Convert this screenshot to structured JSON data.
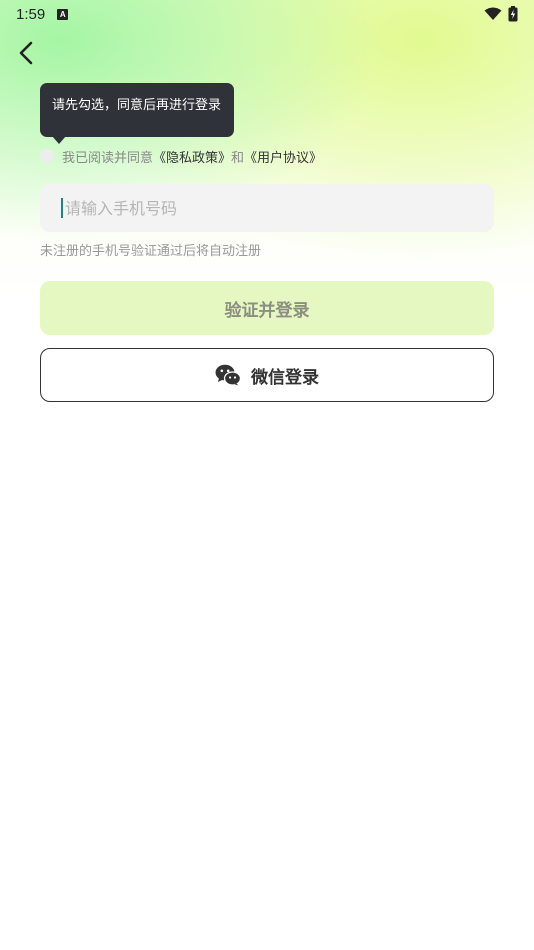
{
  "status_bar": {
    "time": "1:59",
    "notification_icon": "a-icon",
    "wifi_icon": "wifi-icon",
    "battery_icon": "battery-charging-icon"
  },
  "nav": {
    "back_icon": "chevron-left-icon"
  },
  "tooltip": {
    "text": "请先勾选，同意后再进行登录"
  },
  "agreement": {
    "prefix": "我已阅读并同意",
    "privacy_link": "《隐私政策》",
    "and": "和",
    "user_agreement_link": "《用户协议》",
    "checked": false
  },
  "phone_input": {
    "placeholder": "请输入手机号码",
    "value": ""
  },
  "hint": "未注册的手机号验证通过后将自动注册",
  "verify_button": {
    "label": "验证并登录",
    "enabled": false
  },
  "wechat_button": {
    "label": "微信登录",
    "icon": "wechat-icon"
  },
  "colors": {
    "verify_bg": "#e6f8c1",
    "tooltip_bg": "#2f3238",
    "caret": "#1a8a7a"
  }
}
